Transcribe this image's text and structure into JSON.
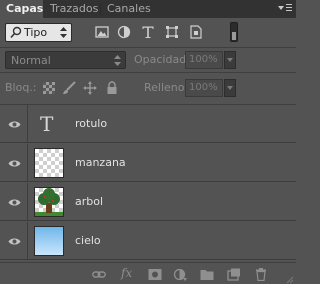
{
  "tabs": [
    {
      "label": "Capas",
      "active": true
    },
    {
      "label": "Trazados",
      "active": false
    },
    {
      "label": "Canales",
      "active": false
    }
  ],
  "filter": {
    "kind_label": "Tipo",
    "icons": [
      "image-filter-icon",
      "adjustment-filter-icon",
      "type-filter-icon",
      "shape-filter-icon",
      "smart-object-filter-icon"
    ]
  },
  "blend": {
    "mode": "Normal",
    "opacity_label": "Opacidad:",
    "opacity_value": "100%",
    "lock_label": "Bloq.:",
    "fill_label": "Relleno:",
    "fill_value": "100%"
  },
  "layers": [
    {
      "name": "rotulo",
      "type": "text",
      "visible": true
    },
    {
      "name": "manzana",
      "type": "pixel",
      "visible": true
    },
    {
      "name": "arbol",
      "type": "pixel",
      "visible": true
    },
    {
      "name": "cielo",
      "type": "pixel",
      "visible": true
    }
  ],
  "bottom_icons": [
    "link-icon",
    "fx-icon",
    "mask-icon",
    "adjustment-icon",
    "folder-icon",
    "new-layer-icon",
    "trash-icon"
  ],
  "colors": {
    "panel_bg": "#535353",
    "tabbar_bg": "#323232",
    "sky_top": "#6fb7ea",
    "tree_green": "#2f6b2f",
    "trunk_brown": "#6b3d1a"
  }
}
